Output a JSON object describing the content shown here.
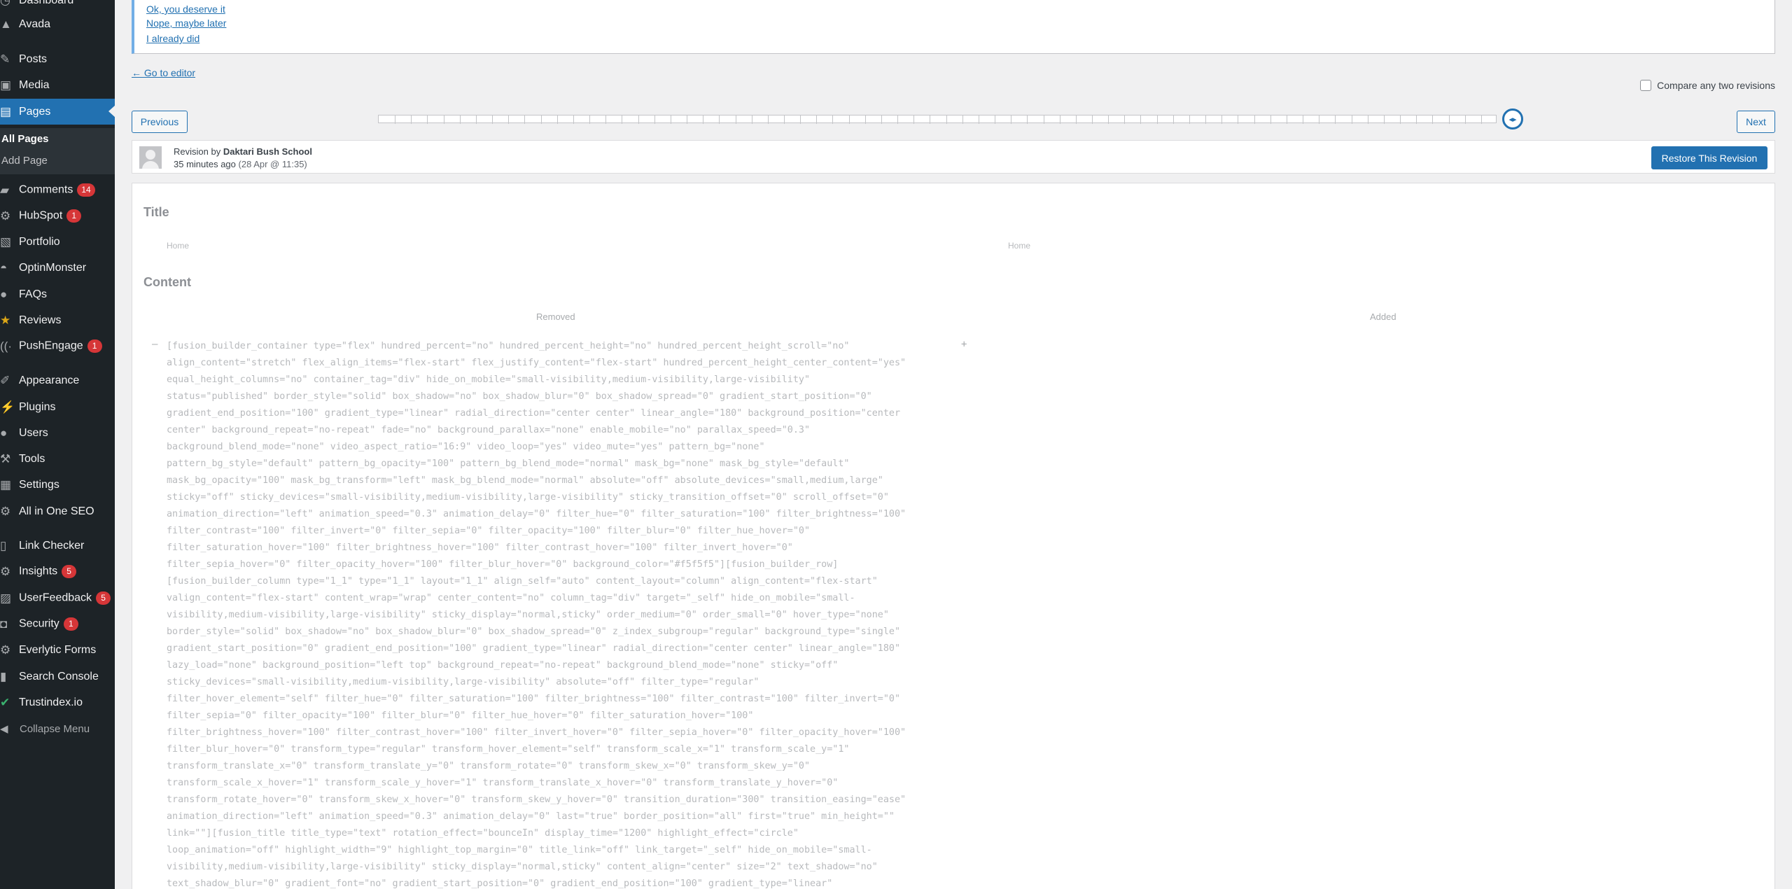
{
  "sidebar": {
    "items": [
      {
        "label": "Dashboard",
        "icon": "dashboard-icon"
      },
      {
        "label": "Avada",
        "icon": "avada-icon"
      },
      {
        "label": "Posts",
        "icon": "pushpin-icon"
      },
      {
        "label": "Media",
        "icon": "media-icon"
      },
      {
        "label": "Pages",
        "icon": "pages-icon",
        "current": true
      },
      {
        "label": "Comments",
        "icon": "comment-icon",
        "badge": "14"
      },
      {
        "label": "HubSpot",
        "icon": "hubspot-icon",
        "badge": "1"
      },
      {
        "label": "Portfolio",
        "icon": "portfolio-icon"
      },
      {
        "label": "OptinMonster",
        "icon": "optinmonster-icon"
      },
      {
        "label": "FAQs",
        "icon": "info-icon"
      },
      {
        "label": "Reviews",
        "icon": "star-icon"
      },
      {
        "label": "PushEngage",
        "icon": "pushengage-icon",
        "badge": "1"
      },
      {
        "label": "Appearance",
        "icon": "brush-icon"
      },
      {
        "label": "Plugins",
        "icon": "plugin-icon"
      },
      {
        "label": "Users",
        "icon": "user-icon"
      },
      {
        "label": "Tools",
        "icon": "wrench-icon"
      },
      {
        "label": "Settings",
        "icon": "settings-icon"
      },
      {
        "label": "All in One SEO",
        "icon": "seo-icon"
      },
      {
        "label": "Link Checker",
        "icon": "link-icon"
      },
      {
        "label": "Insights",
        "icon": "insights-icon",
        "badge": "5"
      },
      {
        "label": "UserFeedback",
        "icon": "feedback-icon",
        "badge": "5"
      },
      {
        "label": "Security",
        "icon": "lock-icon",
        "badge": "1"
      },
      {
        "label": "Everlytic Forms",
        "icon": "gear-icon"
      },
      {
        "label": "Search Console",
        "icon": "bar-chart-icon"
      },
      {
        "label": "Trustindex.io",
        "icon": "check-circle-icon"
      }
    ],
    "submenu": [
      {
        "label": "All Pages",
        "current": true
      },
      {
        "label": "Add Page"
      }
    ],
    "collapse_label": "Collapse Menu",
    "accent_color": "#2271b1"
  },
  "notice": {
    "links": [
      "Ok, you deserve it",
      "Nope, maybe later",
      "I already did"
    ]
  },
  "go_to_editor": "← Go to editor",
  "compare_label": "Compare any two revisions",
  "prev_label": "Previous",
  "next_label": "Next",
  "slider": {
    "tick_count": 69,
    "position": 1.0
  },
  "revision": {
    "by_prefix": "Revision by",
    "author": "Daktari Bush School",
    "time_ago": "35 minutes ago",
    "date": "(28 Apr @ 11:35)",
    "restore_label": "Restore This Revision"
  },
  "diff": {
    "title_heading": "Title",
    "title_removed": "Home",
    "title_added": "Home",
    "content_heading": "Content",
    "removed_label": "Removed",
    "added_label": "Added",
    "removed_sign": "–",
    "added_sign": "+",
    "lines": [
      "[fusion_builder_container type=\"flex\" hundred_percent=\"no\" hundred_percent_height=\"no\" hundred_percent_height_scroll=\"no\"",
      "align_content=\"stretch\" flex_align_items=\"flex-start\" flex_justify_content=\"flex-start\" hundred_percent_height_center_content=\"yes\"",
      "equal_height_columns=\"no\" container_tag=\"div\" hide_on_mobile=\"small-visibility,medium-visibility,large-visibility\"",
      "status=\"published\" border_style=\"solid\" box_shadow=\"no\" box_shadow_blur=\"0\" box_shadow_spread=\"0\" gradient_start_position=\"0\"",
      "gradient_end_position=\"100\" gradient_type=\"linear\" radial_direction=\"center center\" linear_angle=\"180\" background_position=\"center",
      "center\" background_repeat=\"no-repeat\" fade=\"no\" background_parallax=\"none\" enable_mobile=\"no\" parallax_speed=\"0.3\"",
      "background_blend_mode=\"none\" video_aspect_ratio=\"16:9\" video_loop=\"yes\" video_mute=\"yes\" pattern_bg=\"none\"",
      "pattern_bg_style=\"default\" pattern_bg_opacity=\"100\" pattern_bg_blend_mode=\"normal\" mask_bg=\"none\" mask_bg_style=\"default\"",
      "mask_bg_opacity=\"100\" mask_bg_transform=\"left\" mask_bg_blend_mode=\"normal\" absolute=\"off\" absolute_devices=\"small,medium,large\"",
      "sticky=\"off\" sticky_devices=\"small-visibility,medium-visibility,large-visibility\" sticky_transition_offset=\"0\" scroll_offset=\"0\"",
      "animation_direction=\"left\" animation_speed=\"0.3\" animation_delay=\"0\" filter_hue=\"0\" filter_saturation=\"100\" filter_brightness=\"100\"",
      "filter_contrast=\"100\" filter_invert=\"0\" filter_sepia=\"0\" filter_opacity=\"100\" filter_blur=\"0\" filter_hue_hover=\"0\"",
      "filter_saturation_hover=\"100\" filter_brightness_hover=\"100\" filter_contrast_hover=\"100\" filter_invert_hover=\"0\"",
      "filter_sepia_hover=\"0\" filter_opacity_hover=\"100\" filter_blur_hover=\"0\" background_color=\"#f5f5f5\"][fusion_builder_row]",
      "[fusion_builder_column type=\"1_1\" type=\"1_1\" layout=\"1_1\" align_self=\"auto\" content_layout=\"column\" align_content=\"flex-start\"",
      "valign_content=\"flex-start\" content_wrap=\"wrap\" center_content=\"no\" column_tag=\"div\" target=\"_self\" hide_on_mobile=\"small-",
      "visibility,medium-visibility,large-visibility\" sticky_display=\"normal,sticky\" order_medium=\"0\" order_small=\"0\" hover_type=\"none\"",
      "border_style=\"solid\" box_shadow=\"no\" box_shadow_blur=\"0\" box_shadow_spread=\"0\" z_index_subgroup=\"regular\" background_type=\"single\"",
      "gradient_start_position=\"0\" gradient_end_position=\"100\" gradient_type=\"linear\" radial_direction=\"center center\" linear_angle=\"180\"",
      "lazy_load=\"none\" background_position=\"left top\" background_repeat=\"no-repeat\" background_blend_mode=\"none\" sticky=\"off\"",
      "sticky_devices=\"small-visibility,medium-visibility,large-visibility\" absolute=\"off\" filter_type=\"regular\"",
      "filter_hover_element=\"self\" filter_hue=\"0\" filter_saturation=\"100\" filter_brightness=\"100\" filter_contrast=\"100\" filter_invert=\"0\"",
      "filter_sepia=\"0\" filter_opacity=\"100\" filter_blur=\"0\" filter_hue_hover=\"0\" filter_saturation_hover=\"100\"",
      "filter_brightness_hover=\"100\" filter_contrast_hover=\"100\" filter_invert_hover=\"0\" filter_sepia_hover=\"0\" filter_opacity_hover=\"100\"",
      "filter_blur_hover=\"0\" transform_type=\"regular\" transform_hover_element=\"self\" transform_scale_x=\"1\" transform_scale_y=\"1\"",
      "transform_translate_x=\"0\" transform_translate_y=\"0\" transform_rotate=\"0\" transform_skew_x=\"0\" transform_skew_y=\"0\"",
      "transform_scale_x_hover=\"1\" transform_scale_y_hover=\"1\" transform_translate_x_hover=\"0\" transform_translate_y_hover=\"0\"",
      "transform_rotate_hover=\"0\" transform_skew_x_hover=\"0\" transform_skew_y_hover=\"0\" transition_duration=\"300\" transition_easing=\"ease\"",
      "animation_direction=\"left\" animation_speed=\"0.3\" animation_delay=\"0\" last=\"true\" border_position=\"all\" first=\"true\" min_height=\"\"",
      "link=\"\"][fusion_title title_type=\"text\" rotation_effect=\"bounceIn\" display_time=\"1200\" highlight_effect=\"circle\"",
      "loop_animation=\"off\" highlight_width=\"9\" highlight_top_margin=\"0\" title_link=\"off\" link_target=\"_self\" hide_on_mobile=\"small-",
      "visibility,medium-visibility,large-visibility\" sticky_display=\"normal,sticky\" content_align=\"center\" size=\"2\" text_shadow=\"no\"",
      "text_shadow_blur=\"0\" gradient_font=\"no\" gradient_start_position=\"0\" gradient_end_position=\"100\" gradient_type=\"linear\""
    ]
  }
}
